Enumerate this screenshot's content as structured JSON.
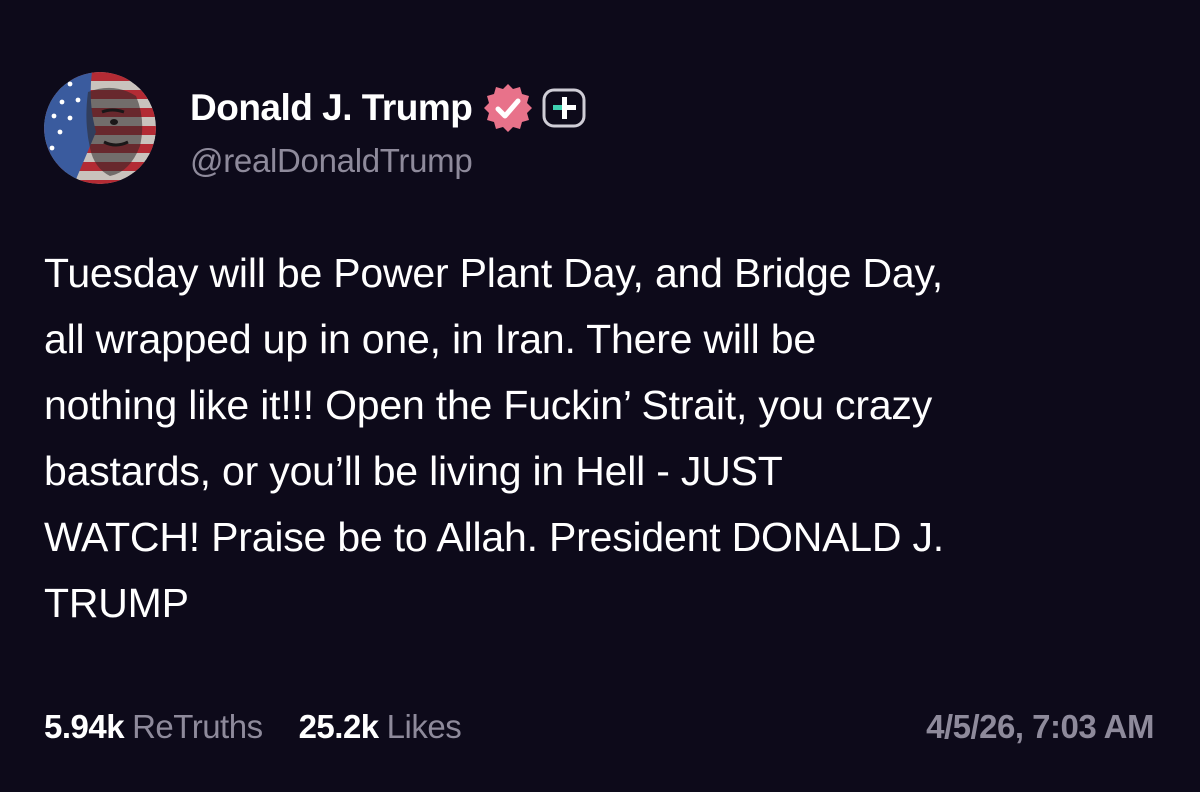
{
  "author": {
    "display_name": "Donald J. Trump",
    "handle": "@realDonaldTrump",
    "avatar_icon": "flag-portrait-avatar",
    "verified_icon": "verified-badge-icon",
    "plus_icon": "plus-badge-icon"
  },
  "post": {
    "lines": [
      "Tuesday will be Power Plant Day, and Bridge Day,",
      "all wrapped up in one, in Iran. There will be",
      "nothing like it!!! Open the Fuckin’ Strait, you crazy",
      "bastards, or you’ll be living in Hell - JUST",
      "WATCH! Praise be to Allah. President DONALD J.",
      "TRUMP"
    ]
  },
  "stats": {
    "retruths_count": "5.94k",
    "retruths_label": "ReTruths",
    "likes_count": "25.2k",
    "likes_label": "Likes"
  },
  "timestamp": "4/5/26, 7:03 AM",
  "colors": {
    "background": "#0d0a1a",
    "text_primary": "#ffffff",
    "text_secondary": "#8e8a9b",
    "verified_badge": "#e8728a",
    "plus_badge_accent": "#3fd0b0"
  }
}
